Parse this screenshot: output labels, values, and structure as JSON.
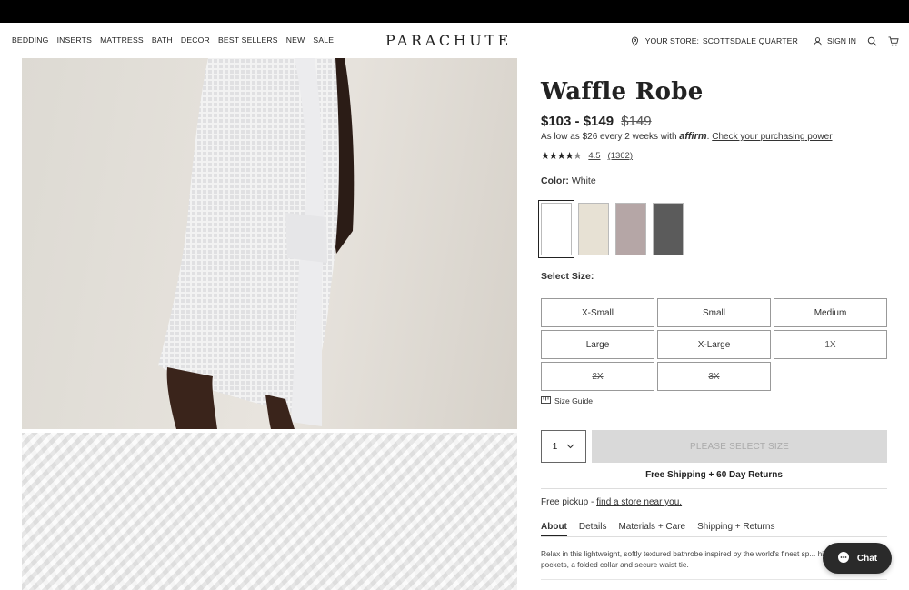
{
  "nav": {
    "links": [
      "BEDDING",
      "INSERTS",
      "MATTRESS",
      "BATH",
      "DECOR",
      "BEST SELLERS",
      "NEW",
      "SALE"
    ],
    "logo": "PARACHUTE",
    "store_prefix": "YOUR STORE:",
    "store_name": "SCOTTSDALE QUARTER",
    "sign_in": "SIGN IN"
  },
  "product": {
    "title": "Waffle Robe",
    "price_range": "$103 - $149",
    "price_original": "$149",
    "affirm_text": "As low as $26 every 2 weeks with",
    "affirm_brand": "affirm",
    "affirm_link": "Check your purchasing power",
    "rating": "4.5",
    "reviews": "(1362)",
    "color_label": "Color:",
    "color_value": "White",
    "swatches": [
      {
        "name": "White",
        "color": "#ffffff"
      },
      {
        "name": "Bone",
        "color": "#e7e1d4"
      },
      {
        "name": "Mauve",
        "color": "#b5a6a6"
      },
      {
        "name": "Charcoal",
        "color": "#5b5b5b"
      }
    ],
    "size_label": "Select Size:",
    "sizes": [
      {
        "label": "X-Small",
        "oos": false
      },
      {
        "label": "Small",
        "oos": false
      },
      {
        "label": "Medium",
        "oos": false
      },
      {
        "label": "Large",
        "oos": false
      },
      {
        "label": "X-Large",
        "oos": false
      },
      {
        "label": "1X",
        "oos": true
      },
      {
        "label": "2X",
        "oos": true
      },
      {
        "label": "3X",
        "oos": true
      }
    ],
    "size_guide": "Size Guide",
    "quantity": "1",
    "cta": "PLEASE SELECT SIZE",
    "shipping": "Free Shipping + 60 Day Returns",
    "pickup_text": "Free pickup -",
    "pickup_link": "find a store near you.",
    "tabs": [
      "About",
      "Details",
      "Materials + Care",
      "Shipping + Returns"
    ],
    "about_text": "Relax in this lightweight, softly textured bathrobe inspired by the world's finest sp... hip pockets, a folded collar and secure waist tie."
  },
  "chat": {
    "label": "Chat"
  }
}
